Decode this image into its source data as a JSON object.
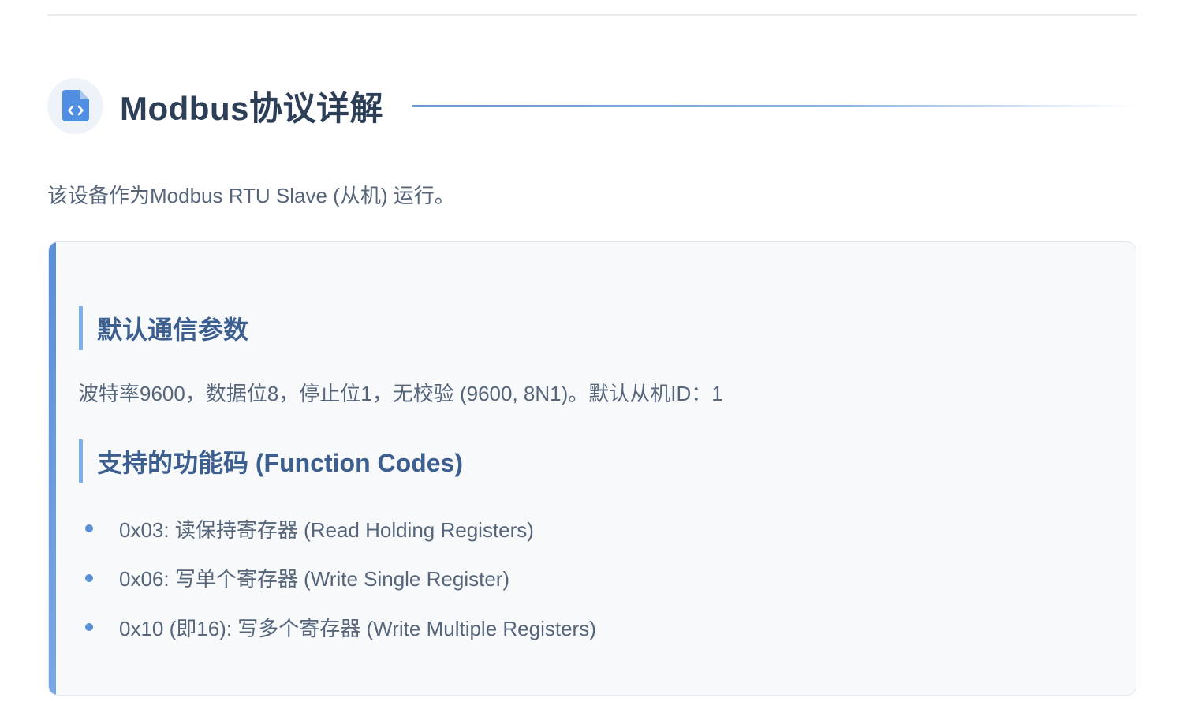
{
  "section": {
    "title": "Modbus协议详解",
    "icon": "file-code-icon",
    "intro": "该设备作为Modbus RTU Slave (从机) 运行。"
  },
  "card": {
    "params_heading": "默认通信参数",
    "params_text": "波特率9600，数据位8，停止位1，无校验 (9600, 8N1)。默认从机ID：1",
    "codes_heading": "支持的功能码 (Function Codes)",
    "function_codes": [
      "0x03: 读保持寄存器 (Read Holding Registers)",
      "0x06: 写单个寄存器 (Write Single Register)",
      "0x10 (即16): 写多个寄存器 (Write Multiple Registers)"
    ]
  },
  "colors": {
    "accent": "#5b8fd6",
    "title": "#2d3e57",
    "subheading": "#3c5f90",
    "body_text": "#56657a",
    "card_bg": "#f7f9fb"
  }
}
